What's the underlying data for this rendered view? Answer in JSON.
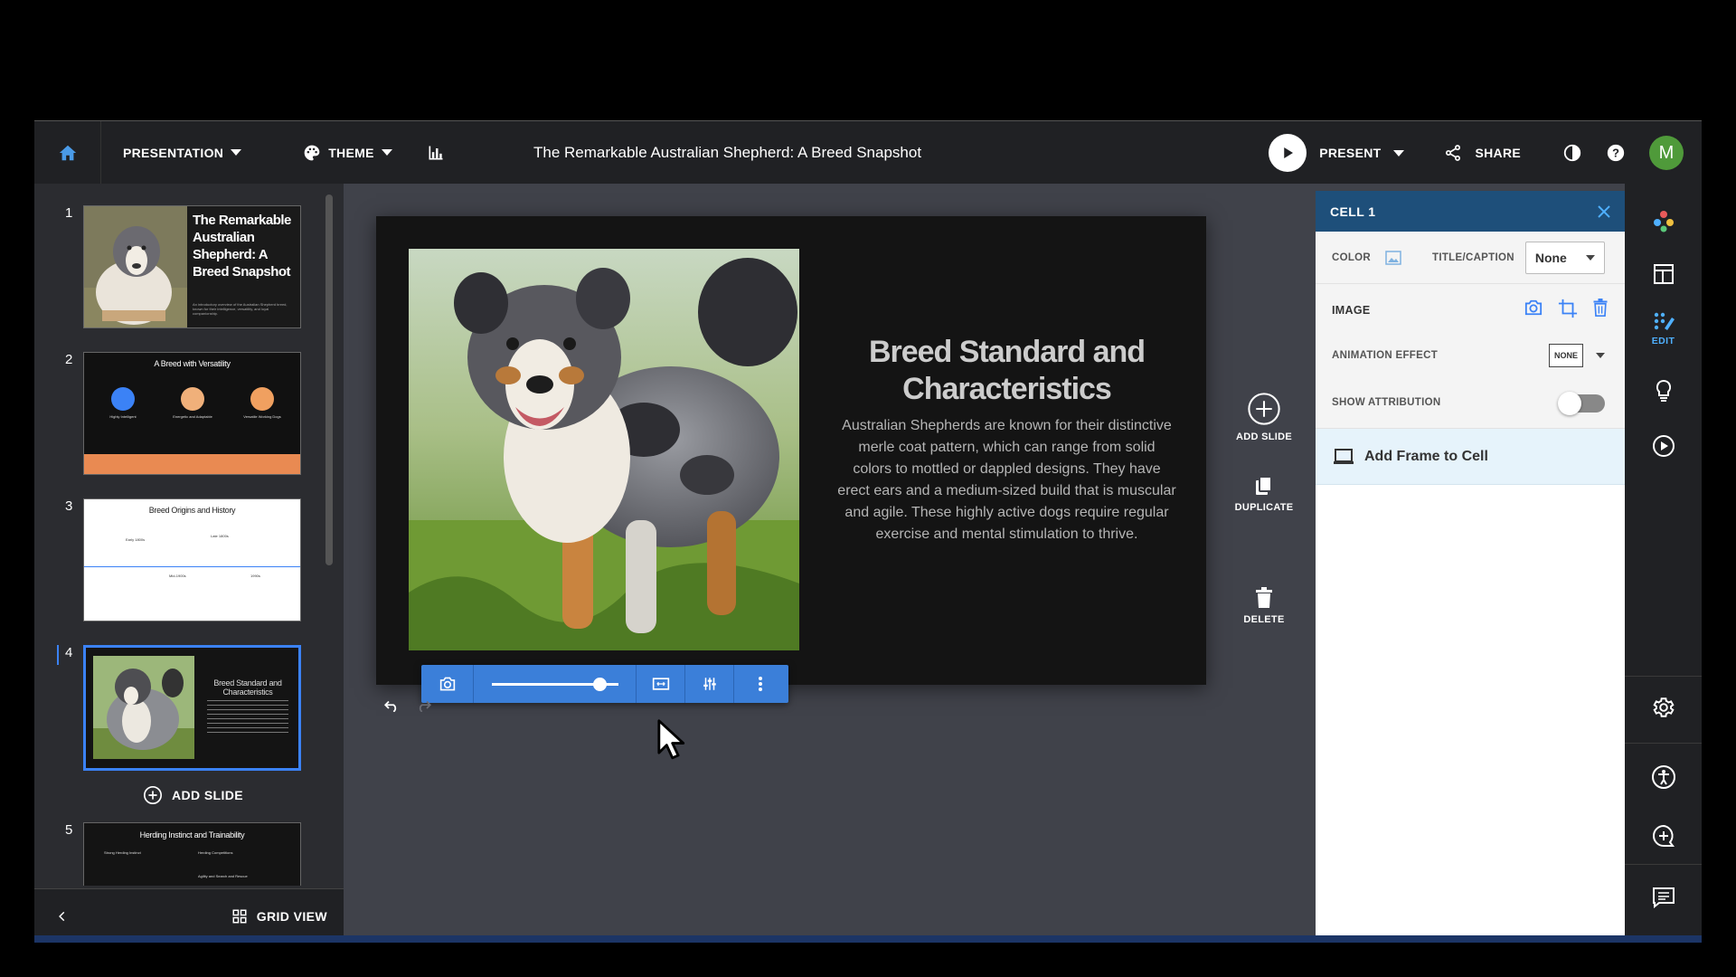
{
  "topbar": {
    "presentation_label": "PRESENTATION",
    "theme_label": "THEME",
    "doc_title": "The Remarkable Australian Shepherd: A Breed Snapshot",
    "present_label": "PRESENT",
    "share_label": "SHARE",
    "avatar_initial": "M"
  },
  "slides": [
    {
      "num": "1",
      "title": "The Remarkable Australian Shepherd: A Breed Snapshot",
      "subtitle": "An introductory overview of the Australian Shepherd breed, known for their intelligence, versatility, and loyal companionship."
    },
    {
      "num": "2",
      "title": "A Breed with Versatility",
      "features": [
        "Highly Intelligent",
        "Energetic and Adaptable",
        "Versatile Working Dogs"
      ]
    },
    {
      "num": "3",
      "title": "Breed Origins and History",
      "points": [
        "Early 1800s",
        "Late 1800s",
        "Mid-1900s",
        "1990s"
      ]
    },
    {
      "num": "4",
      "title": "Breed Standard and Characteristics"
    },
    {
      "num": "5",
      "title": "Herding Instinct and Trainability",
      "points": [
        "Strong Herding Instinct",
        "Herding Competitions",
        "Agility and Search and Rescue"
      ]
    }
  ],
  "left_panel": {
    "add_slide_label": "ADD SLIDE",
    "grid_view_label": "GRID VIEW"
  },
  "current_slide": {
    "heading": "Breed Standard and Characteristics",
    "body": "Australian Shepherds are known for their distinctive merle coat pattern, which can range from solid colors to mottled or dappled designs. They have erect ears and a medium-sized build that is muscular and agile. These highly active dogs require regular exercise and mental stimulation to thrive.",
    "zoom_level": 0.85
  },
  "side_actions": {
    "add_slide": "ADD SLIDE",
    "duplicate": "DUPLICATE",
    "delete": "DELETE"
  },
  "properties": {
    "header": "CELL 1",
    "color_label": "COLOR",
    "title_caption_label": "TITLE/CAPTION",
    "title_caption_value": "None",
    "image_label": "IMAGE",
    "animation_label": "ANIMATION EFFECT",
    "animation_value": "NONE",
    "attribution_label": "SHOW ATTRIBUTION",
    "attribution_on": false,
    "add_frame_label": "Add Frame to Cell"
  },
  "rail": {
    "edit_label": "EDIT"
  },
  "colors": {
    "accent": "#3b7fd9",
    "panel_header": "#1e4f7a",
    "avatar": "#4f9a3a"
  }
}
